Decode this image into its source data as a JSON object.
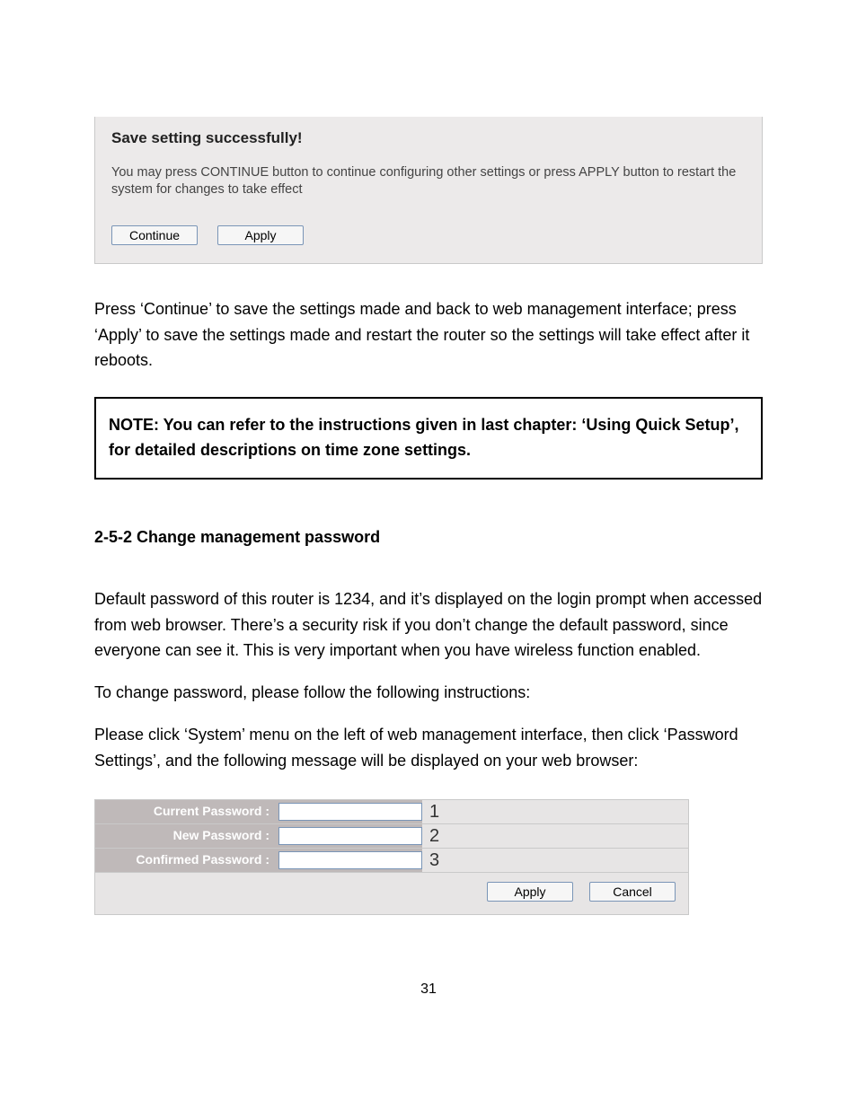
{
  "save_panel": {
    "title": "Save setting successfully!",
    "body": "You may press CONTINUE button to continue configuring other settings or press APPLY button to restart the system for changes to take effect",
    "continue_label": "Continue",
    "apply_label": "Apply"
  },
  "body_para_1": "Press ‘Continue’ to save the settings made and back to web management interface; press ‘Apply’ to save the settings made and restart the router so the settings will take effect after it reboots.",
  "note_box": "NOTE: You can refer to the instructions given in last chapter: ‘Using Quick Setup’, for detailed descriptions on time zone settings.",
  "section_heading": "2-5-2 Change management password",
  "body_para_2": "Default password of this router is 1234, and it’s displayed on the login prompt when accessed from web browser. There’s a security risk if you don’t change the default password, since everyone can see it. This is very important when you have wireless function enabled.",
  "body_para_3": "To change password, please follow the following instructions:",
  "body_para_4": "Please click ‘System’ menu on the left of web management interface, then click ‘Password Settings’, and the following message will be displayed on your web browser:",
  "pw_panel": {
    "rows": [
      {
        "label": "Current Password :",
        "num": "1"
      },
      {
        "label": "New Password :",
        "num": "2"
      },
      {
        "label": "Confirmed Password :",
        "num": "3"
      }
    ],
    "apply_label": "Apply",
    "cancel_label": "Cancel"
  },
  "page_number": "31"
}
